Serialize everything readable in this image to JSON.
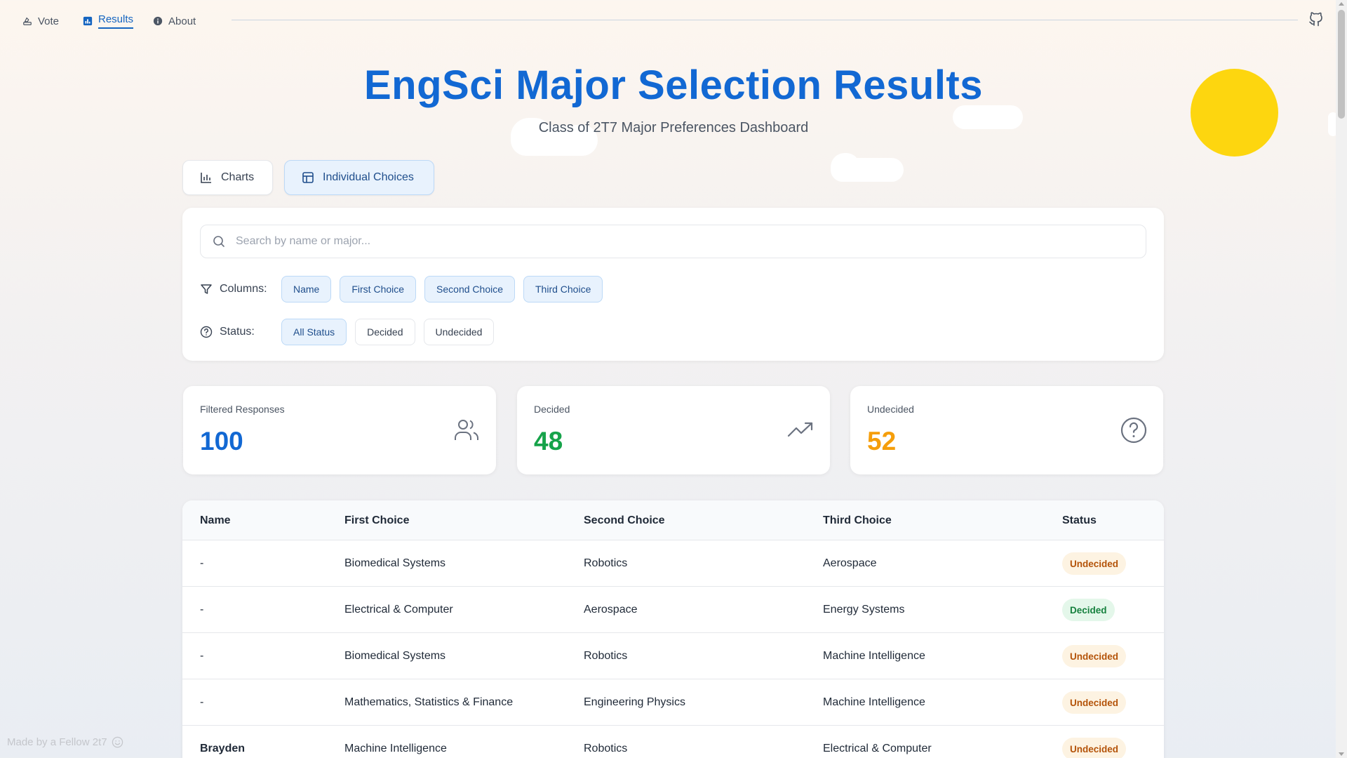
{
  "nav": {
    "items": [
      {
        "label": "Vote",
        "icon": "ballot-icon"
      },
      {
        "label": "Results",
        "icon": "bar-chart-icon"
      },
      {
        "label": "About",
        "icon": "info-icon"
      }
    ],
    "active": "Results"
  },
  "header": {
    "title": "EngSci Major Selection Results",
    "subtitle": "Class of 2T7 Major Preferences Dashboard"
  },
  "tabs": [
    {
      "label": "Charts",
      "active": false
    },
    {
      "label": "Individual Choices",
      "active": true
    }
  ],
  "search": {
    "placeholder": "Search by name or major..."
  },
  "filters": {
    "columns_label": "Columns:",
    "columns": [
      "Name",
      "First Choice",
      "Second Choice",
      "Third Choice"
    ],
    "status_label": "Status:",
    "status": [
      "All Status",
      "Decided",
      "Undecided"
    ],
    "status_selected": "All Status"
  },
  "stats": [
    {
      "label": "Filtered Responses",
      "value": "100",
      "color": "#1268d3",
      "icon": "users-icon"
    },
    {
      "label": "Decided",
      "value": "48",
      "color": "#16a34a",
      "icon": "trending-up-icon"
    },
    {
      "label": "Undecided",
      "value": "52",
      "color": "#f59e0b",
      "icon": "help-circle-icon"
    }
  ],
  "table": {
    "headers": [
      "Name",
      "First Choice",
      "Second Choice",
      "Third Choice",
      "Status"
    ],
    "rows": [
      {
        "name": "-",
        "first": "Biomedical Systems",
        "second": "Robotics",
        "third": "Aerospace",
        "status": "Undecided"
      },
      {
        "name": "-",
        "first": "Electrical & Computer",
        "second": "Aerospace",
        "third": "Energy Systems",
        "status": "Decided"
      },
      {
        "name": "-",
        "first": "Biomedical Systems",
        "second": "Robotics",
        "third": "Machine Intelligence",
        "status": "Undecided"
      },
      {
        "name": "-",
        "first": "Mathematics, Statistics & Finance",
        "second": "Engineering Physics",
        "third": "Machine Intelligence",
        "status": "Undecided"
      },
      {
        "name": "Brayden",
        "first": "Machine Intelligence",
        "second": "Robotics",
        "third": "Electrical & Computer",
        "status": "Undecided"
      }
    ]
  },
  "footer": {
    "text": "Made by a Fellow 2t7"
  },
  "colors": {
    "accent": "#1268d3",
    "sun": "#fdd60f"
  }
}
